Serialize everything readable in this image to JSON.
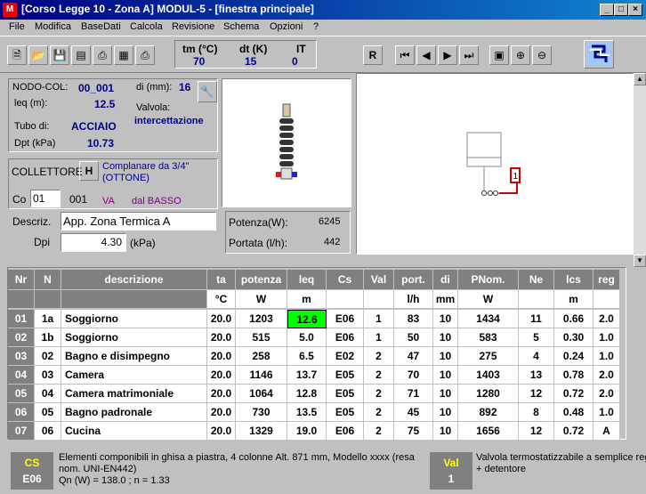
{
  "window": {
    "app_icon": "M",
    "title": "[Corso Legge 10 - Zona A] MODUL-5 - [finestra principale]",
    "controls": [
      "_",
      "□",
      "×"
    ]
  },
  "menu": [
    "File",
    "Modifica",
    "BaseDati",
    "Calcola",
    "Revisione",
    "Schema",
    "Opzioni",
    "?"
  ],
  "toolbar": {
    "params": {
      "tm_label": "tm (°C)",
      "tm_value": "70",
      "dt_label": "dt (K)",
      "dt_value": "15",
      "it_label": "IT",
      "it_value": "0"
    },
    "r_button": "R"
  },
  "node": {
    "nodo_col_label": "NODO-COL:",
    "nodo_col_value": "00_001",
    "leq_label": "leq (m):",
    "leq_value": "12.5",
    "tubo_label": "Tubo di:",
    "tubo_value": "ACCIAIO",
    "dpt_label": "Dpt (kPa)",
    "dpt_value": "10.73",
    "di_label": "di (mm):",
    "di_value": "16",
    "valvola_label": "Valvola:",
    "valvola_value": "intercettazione"
  },
  "collettore": {
    "label": "COLLETTORE",
    "h_button": "H",
    "desc": "Complanare da 3/4\" (OTTONE)",
    "co_label": "Co",
    "co_value": "01",
    "co_num": "001",
    "va": "VA",
    "dal": "dal BASSO"
  },
  "descr": {
    "label": "Descriz.",
    "value": "App. Zona Termica A",
    "dpi_label": "Dpi",
    "dpi_value": "4.30",
    "dpi_unit": "(kPa)"
  },
  "power": {
    "potenza_label": "Potenza(W):",
    "potenza_value": "6245",
    "portata_label": "Portata (l/h):",
    "portata_value": "442"
  },
  "schema": {
    "node_label": "1"
  },
  "table": {
    "headers": [
      "Nr",
      "N",
      "descrizione",
      "ta",
      "potenza",
      "leq",
      "Cs",
      "Val",
      "port.",
      "di",
      "PNom.",
      "Ne",
      "lcs",
      "reg"
    ],
    "units": [
      "",
      "",
      "",
      "°C",
      "W",
      "m",
      "",
      "",
      "l/h",
      "mm",
      "W",
      "",
      "m",
      ""
    ],
    "rows": [
      [
        "01",
        "1a",
        "Soggiorno",
        "20.0",
        "1203",
        "12.6",
        "E06",
        "1",
        "83",
        "10",
        "1434",
        "11",
        "0.66",
        "2.0"
      ],
      [
        "02",
        "1b",
        "Soggiorno",
        "20.0",
        "515",
        "5.0",
        "E06",
        "1",
        "50",
        "10",
        "583",
        "5",
        "0.30",
        "1.0"
      ],
      [
        "03",
        "02",
        "Bagno e disimpegno",
        "20.0",
        "258",
        "6.5",
        "E02",
        "2",
        "47",
        "10",
        "275",
        "4",
        "0.24",
        "1.0"
      ],
      [
        "04",
        "03",
        "Camera",
        "20.0",
        "1146",
        "13.7",
        "E05",
        "2",
        "70",
        "10",
        "1403",
        "13",
        "0.78",
        "2.0"
      ],
      [
        "05",
        "04",
        "Camera matrimoniale",
        "20.0",
        "1064",
        "12.8",
        "E05",
        "2",
        "71",
        "10",
        "1280",
        "12",
        "0.72",
        "2.0"
      ],
      [
        "06",
        "05",
        "Bagno padronale",
        "20.0",
        "730",
        "13.5",
        "E05",
        "2",
        "45",
        "10",
        "892",
        "8",
        "0.48",
        "1.0"
      ],
      [
        "07",
        "06",
        "Cucina",
        "20.0",
        "1329",
        "19.0",
        "E06",
        "2",
        "75",
        "10",
        "1656",
        "12",
        "0.72",
        "A"
      ]
    ]
  },
  "footer": {
    "cs_label": "CS",
    "cs_value": "E06",
    "cs_desc_line1": "Elementi componibili in ghisa a piastra, 4 colonne Alt. 871 mm, Modello xxxx (resa",
    "cs_desc_line2": "nom. UNI-EN442)",
    "cs_desc_line3": "Qn (W) = 138.0 ; n = 1.33",
    "val_label": "Val",
    "val_value": "1",
    "val_desc_line1": "Valvola termostatizzabile a semplice reg",
    "val_desc_line2": "+ detentore"
  },
  "colors": {
    "title_start": "#000080",
    "highlight": "#00ff00",
    "label_blue": "#00008b",
    "pipe_red": "#cc0000"
  }
}
